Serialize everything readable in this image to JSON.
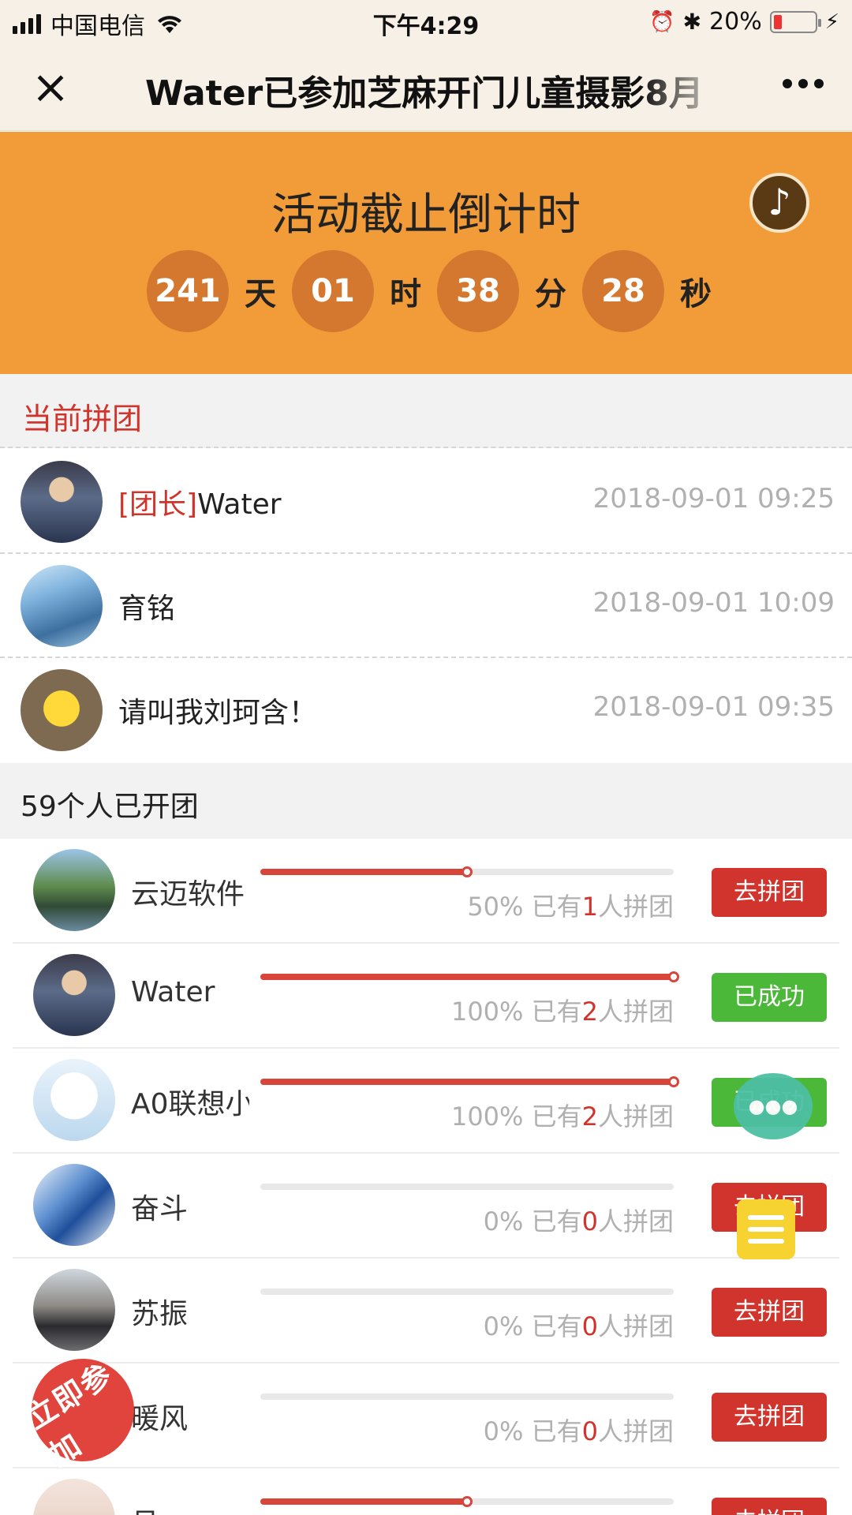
{
  "status_bar": {
    "carrier": "中国电信",
    "time": "下午4:29",
    "battery": "20%"
  },
  "nav": {
    "title": "Water已参加芝麻开门儿童摄影8月"
  },
  "countdown": {
    "title": "活动截止倒计时",
    "days": "241",
    "days_unit": "天",
    "hours": "01",
    "hours_unit": "时",
    "minutes": "38",
    "minutes_unit": "分",
    "seconds": "28",
    "seconds_unit": "秒"
  },
  "current_group": {
    "title": "当前拼团",
    "members": [
      {
        "tag": "[团长]",
        "name": "Water",
        "time": "2018-09-01 09:25"
      },
      {
        "tag": "",
        "name": "育铭",
        "time": "2018-09-01 10:09"
      },
      {
        "tag": "",
        "name": "请叫我刘珂含！",
        "time": "2018-09-01 09:35"
      }
    ]
  },
  "groups": {
    "title": "59个人已开团",
    "rows": [
      {
        "name": "云迈软件",
        "percent_text": "50%",
        "count_prefix": "已有",
        "count": "1",
        "count_suffix": "人拼团",
        "progress": 0.5,
        "button": "去拼团",
        "button_color": "red"
      },
      {
        "name": "Water",
        "percent_text": "100%",
        "count_prefix": "已有",
        "count": "2",
        "count_suffix": "人拼团",
        "progress": 1.0,
        "button": "已成功",
        "button_color": "green"
      },
      {
        "name": "A0联想小",
        "percent_text": "100%",
        "count_prefix": "已有",
        "count": "2",
        "count_suffix": "人拼团",
        "progress": 1.0,
        "button": "已成功",
        "button_color": "green"
      },
      {
        "name": "奋斗",
        "percent_text": "0%",
        "count_prefix": "已有",
        "count": "0",
        "count_suffix": "人拼团",
        "progress": 0,
        "button": "去拼团",
        "button_color": "red"
      },
      {
        "name": "苏振",
        "percent_text": "0%",
        "count_prefix": "已有",
        "count": "0",
        "count_suffix": "人拼团",
        "progress": 0,
        "button": "去拼团",
        "button_color": "red"
      },
      {
        "name": "暖风",
        "percent_text": "0%",
        "count_prefix": "已有",
        "count": "0",
        "count_suffix": "人拼团",
        "progress": 0,
        "button": "去拼团",
        "button_color": "red"
      },
      {
        "name": "吕",
        "percent_text": "",
        "count_prefix": "",
        "count": "",
        "count_suffix": "",
        "progress": 0.5,
        "button": "去拼团",
        "button_color": "red"
      }
    ]
  },
  "floating": {
    "join_stamp": "立即参加"
  },
  "colors": {
    "accent_red": "#d0342c",
    "success_green": "#4cb83a",
    "countdown_orange": "#f19c38"
  }
}
